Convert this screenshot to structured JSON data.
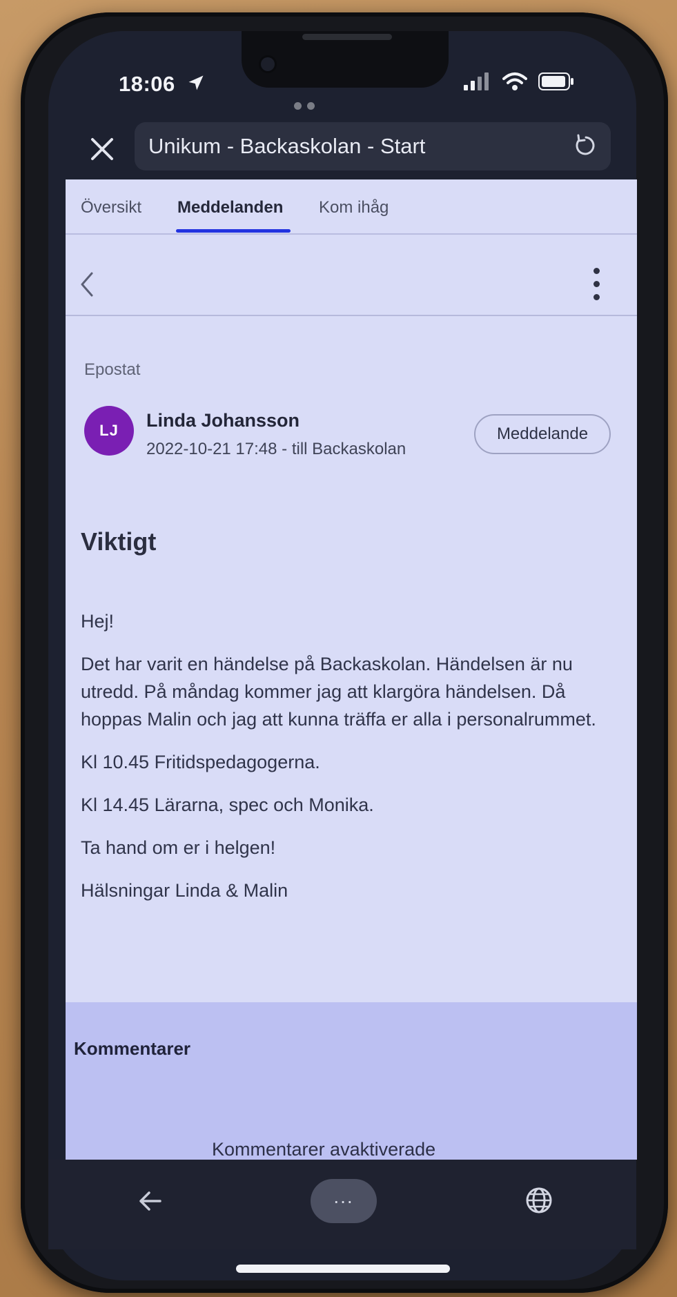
{
  "status_bar": {
    "time": "18:06"
  },
  "browser": {
    "page_title": "Unikum - Backaskolan - Start"
  },
  "tabs": [
    {
      "label": "Översikt",
      "active": false
    },
    {
      "label": "Meddelanden",
      "active": true
    },
    {
      "label": "Kom ihåg",
      "active": false
    }
  ],
  "message": {
    "label": "Epostat",
    "sender": {
      "initials": "LJ",
      "name": "Linda Johansson",
      "meta": "2022-10-21 17:48 - till Backaskolan",
      "avatar_color": "#7a1fb3"
    },
    "action_button": "Meddelande",
    "title": "Viktigt",
    "body": [
      "Hej!",
      "Det har varit en händelse på Backaskolan. Händelsen är nu utredd. På måndag kommer jag att klargöra händelsen. Då hoppas Malin och jag att kunna träffa er alla i personalrummet.",
      "Kl 10.45 Fritidspedagogerna.",
      "Kl 14.45 Lärarna, spec och Monika.",
      "Ta hand om er i helgen!",
      "Hälsningar Linda & Malin"
    ]
  },
  "comments": {
    "heading": "Kommentarer",
    "status": "Kommentarer avaktiverade"
  },
  "bottom_bar": {
    "more": "..."
  },
  "colors": {
    "accent": "#2233e0",
    "content_bg": "#d9dcf7"
  }
}
